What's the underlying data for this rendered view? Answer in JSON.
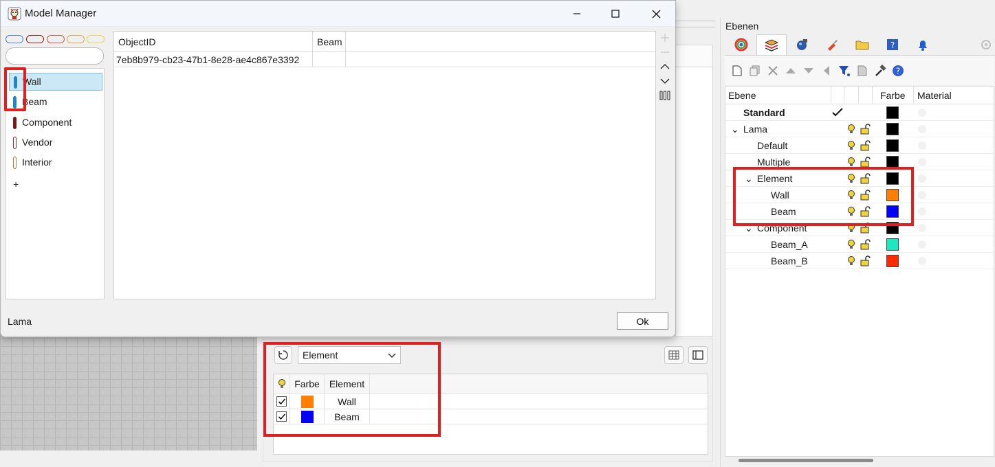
{
  "model_manager": {
    "title": "Model Manager",
    "pills": [
      "#4a86c5",
      "#7a2020",
      "#c55a3a",
      "#e0a83a",
      "#e8d44a"
    ],
    "search_value": "",
    "list": [
      {
        "label": "Wall",
        "color": "#1f86c9",
        "selected": true
      },
      {
        "label": "Beam",
        "color": "#1f86c9",
        "selected": false
      },
      {
        "label": "Component",
        "color": "#7a1a1a",
        "selected": false
      },
      {
        "label": "Vendor",
        "color": "#a01d2a",
        "selected": false
      },
      {
        "label": "Interior",
        "color": "#c86a3a",
        "selected": false
      }
    ],
    "add_label": "+",
    "grid": {
      "headers": [
        "ObjectID",
        "Beam"
      ],
      "rows": [
        [
          "7eb8b979-cb23-47b1-8e28-ae4c867e3392",
          ""
        ]
      ]
    },
    "status": "Lama",
    "ok_label": "Ok"
  },
  "bottom_panel": {
    "dropdown_value": "Element",
    "headers": [
      "Farbe",
      "Element"
    ],
    "rows": [
      {
        "checked": true,
        "color": "#ff8000",
        "name": "Wall"
      },
      {
        "checked": true,
        "color": "#0000ff",
        "name": "Beam"
      }
    ]
  },
  "layers": {
    "title": "Ebenen",
    "headers": {
      "name": "Ebene",
      "color": "Farbe",
      "material": "Material"
    },
    "rows": [
      {
        "name": "Standard",
        "bold": true,
        "current": true,
        "color": "#000000",
        "indent": 0,
        "expander": ""
      },
      {
        "name": "Lama",
        "color": "#000000",
        "indent": 0,
        "expander": "⌄"
      },
      {
        "name": "Default",
        "color": "#000000",
        "indent": 1,
        "expander": ""
      },
      {
        "name": "Multiple",
        "color": "#000000",
        "indent": 1,
        "expander": ""
      },
      {
        "name": "Element",
        "color": "#000000",
        "indent": 1,
        "expander": "⌄"
      },
      {
        "name": "Wall",
        "color": "#ff8000",
        "indent": 2,
        "expander": ""
      },
      {
        "name": "Beam",
        "color": "#0000ff",
        "indent": 2,
        "expander": ""
      },
      {
        "name": "Component",
        "color": "#000000",
        "indent": 1,
        "expander": "⌄"
      },
      {
        "name": "Beam_A",
        "color": "#1de8c0",
        "indent": 2,
        "expander": ""
      },
      {
        "name": "Beam_B",
        "color": "#ff2a00",
        "indent": 2,
        "expander": ""
      }
    ]
  }
}
